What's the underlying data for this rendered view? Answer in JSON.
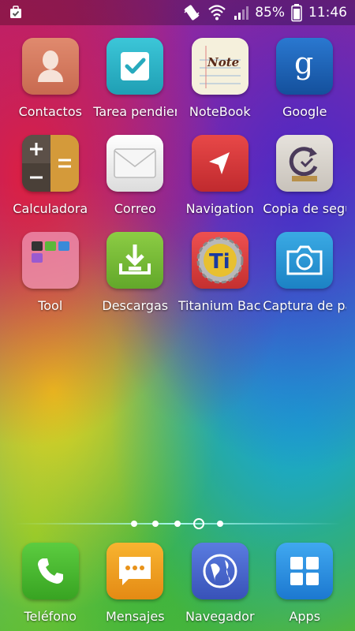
{
  "status_bar": {
    "battery": "85%",
    "time": "11:46",
    "icons": [
      "task-icon",
      "vibrate-icon",
      "wifi-icon",
      "signal-icon",
      "battery-icon"
    ]
  },
  "apps": [
    {
      "label": "Contactos",
      "icon": "contact-icon",
      "color": "#d0785e"
    },
    {
      "label": "Tarea pendiente",
      "icon": "checkmark-icon",
      "color": "#2fb4c8"
    },
    {
      "label": "NoteBook",
      "icon": "notebook-icon",
      "color": "#f4f0dc"
    },
    {
      "label": "Google",
      "icon": "google-icon",
      "color": "#1a62b8"
    },
    {
      "label": "Calculadora",
      "icon": "calculator-icon",
      "color": "#5a4e44"
    },
    {
      "label": "Correo",
      "icon": "mail-icon",
      "color": "#f2f2f2"
    },
    {
      "label": "Navigation",
      "icon": "navigation-icon",
      "color": "#d8363a"
    },
    {
      "label": "Copia de seguridad",
      "icon": "backup-icon",
      "color": "#d8d4ce"
    },
    {
      "label": "Tool",
      "icon": "folder-icon",
      "color": "#e890b0"
    },
    {
      "label": "Descargas",
      "icon": "download-icon",
      "color": "#7cc23c"
    },
    {
      "label": "Titanium Backup",
      "icon": "titanium-icon",
      "color": "#e24040"
    },
    {
      "label": "Captura de pantalla",
      "icon": "camera-icon",
      "color": "#2a9ad6"
    }
  ],
  "dock": [
    {
      "label": "Teléfono",
      "icon": "phone-icon",
      "color": "#46b630"
    },
    {
      "label": "Mensajes",
      "icon": "message-icon",
      "color": "#f0a020"
    },
    {
      "label": "Navegador",
      "icon": "globe-icon",
      "color": "#4a6ad0"
    },
    {
      "label": "Apps",
      "icon": "apps-icon",
      "color": "#2f8fe0"
    }
  ],
  "page_indicator": {
    "pages": 5,
    "current": 4
  }
}
